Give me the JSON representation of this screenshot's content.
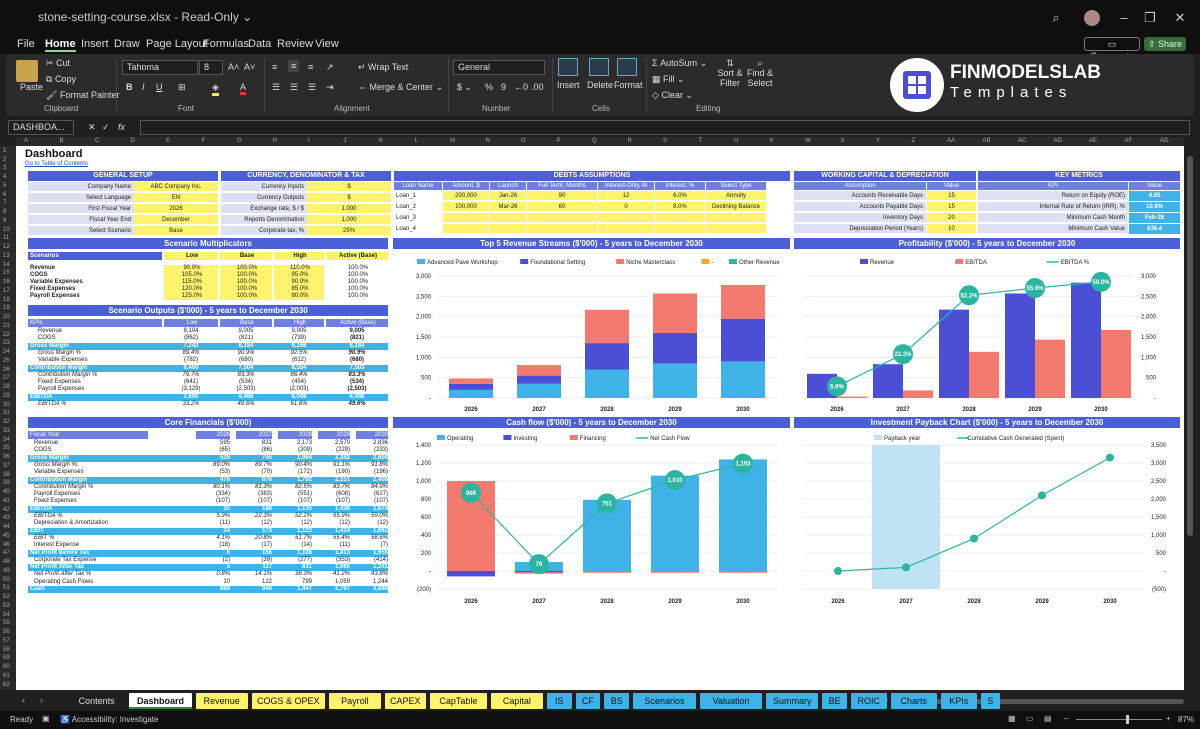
{
  "titlebar": {
    "filename": "stone-setting-course.xlsx",
    "mode": "Read-Only"
  },
  "menus": [
    "File",
    "Home",
    "Insert",
    "Draw",
    "Page Layout",
    "Formulas",
    "Data",
    "Review",
    "View"
  ],
  "menu_right": {
    "comments": "Comments",
    "share": "Share"
  },
  "ribbon": {
    "paste": "Paste",
    "cut": "Cut",
    "copy": "Copy",
    "format_painter": "Format Painter",
    "clipboard": "Clipboard",
    "font_name": "Tahoma",
    "font_size": "8",
    "font": "Font",
    "wrap_text": "Wrap Text",
    "merge_center": "Merge & Center",
    "alignment": "Alignment",
    "number_format": "General",
    "number": "Number",
    "insert": "Insert",
    "delete": "Delete",
    "format": "Format",
    "cells": "Cells",
    "autosum": "AutoSum",
    "fill": "Fill",
    "clear": "Clear",
    "sort_filter": "Sort & Filter",
    "find_select": "Find & Select",
    "editing": "Editing",
    "logo_title": "FINMODELSLAB",
    "logo_sub": "Templates"
  },
  "formula_bar": {
    "name_box": "DASHBOA...",
    "fx": "fx",
    "value": ""
  },
  "columns": [
    "A",
    "B",
    "C",
    "D",
    "E",
    "F",
    "G",
    "H",
    "I",
    "J",
    "K",
    "L",
    "M",
    "N",
    "O",
    "P",
    "Q",
    "R",
    "S",
    "T",
    "U",
    "V",
    "W",
    "X",
    "Y",
    "Z",
    "AA",
    "AB",
    "AC",
    "AD",
    "AE",
    "AF",
    "AG"
  ],
  "sheet": {
    "title": "Dashboard",
    "toc_link": "Go to Table of Contents",
    "general_setup": {
      "header": "GENERAL SETUP",
      "rows": [
        [
          "Company Name",
          "ABC Company Inc."
        ],
        [
          "Select Language",
          "EN"
        ],
        [
          "First Fiscal Year",
          "2026"
        ],
        [
          "Fiscal Year End",
          "December"
        ],
        [
          "Select Scenario",
          "Base"
        ]
      ]
    },
    "currency": {
      "header": "CURRENCY, DENOMINATOR & TAX",
      "rows": [
        [
          "Currency Inputs",
          "$"
        ],
        [
          "Currency Outputs",
          "$"
        ],
        [
          "Exchange rate, $ / $",
          "1.000"
        ],
        [
          "Reports Denomination",
          "1,000"
        ],
        [
          "Corporate tax, %",
          "25%"
        ]
      ]
    },
    "debts": {
      "header": "DEBTS ASSUMPTIONS",
      "cols": [
        "Loan Name",
        "Amount, $",
        "Launch",
        "Full Term, Months",
        "Interest-Only, M",
        "Interest, %",
        "Select Type"
      ],
      "rows": [
        [
          "Loan_1",
          "200,000",
          "Jan-26",
          "90",
          "12",
          "6.0%",
          "Annuity"
        ],
        [
          "Loan_2",
          "100,000",
          "Mar-26",
          "60",
          "0",
          "8.0%",
          "Declining Balance"
        ],
        [
          "Loan_3",
          "",
          "",
          "",
          "",
          "",
          ""
        ],
        [
          "Loan_4",
          "",
          "",
          "",
          "",
          "",
          ""
        ]
      ]
    },
    "working_capital": {
      "header": "WORKING CAPITAL & DEPRECIATION",
      "cols": [
        "Assumption",
        "Value"
      ],
      "rows": [
        [
          "Accounts Receivable Days",
          "15"
        ],
        [
          "Accounts Payable Days",
          "15"
        ],
        [
          "Inventory Days",
          "20"
        ],
        [
          "Depreciation Period (Years)",
          "10"
        ]
      ]
    },
    "key_metrics": {
      "header": "KEY METRICS",
      "cols": [
        "KPI",
        "Value"
      ],
      "rows": [
        [
          "Return on Equity (ROE)",
          "4.65"
        ],
        [
          "Internal Rate of Return (IRR), %",
          "10.8%"
        ],
        [
          "Minimum Cash Month",
          "Feb-26"
        ],
        [
          "Minimum Cash Value",
          "838.4"
        ]
      ]
    },
    "scenario_mult": {
      "header": "Scenario Multiplicators",
      "cols": [
        "Scenarios",
        "Low",
        "Base",
        "High",
        "Active (Base)"
      ],
      "rows": [
        [
          "Revenue",
          "90.0%",
          "100.0%",
          "110.0%",
          "100.0%"
        ],
        [
          "COGS",
          "105.0%",
          "100.0%",
          "95.0%",
          "100.0%"
        ],
        [
          "Variable Expenses",
          "115.0%",
          "100.0%",
          "90.0%",
          "100.0%"
        ],
        [
          "Fixed Expenses",
          "120.0%",
          "100.0%",
          "85.0%",
          "100.0%"
        ],
        [
          "Payroll Expenses",
          "125.0%",
          "100.0%",
          "80.0%",
          "100.0%"
        ]
      ]
    },
    "scenario_out": {
      "header": "Scenario Outputs ($'000) - 5 years to December 2030",
      "cols": [
        "KPIs",
        "Low",
        "Base",
        "High",
        "Active (Base)"
      ],
      "rows": [
        [
          "Revenue",
          "8,104",
          "9,005",
          "9,905",
          "9,005",
          ""
        ],
        [
          "COGS",
          "(862)",
          "(821)",
          "(739)",
          "(821)",
          ""
        ],
        [
          "Gross Margin",
          "7,242",
          "8,184",
          "9,166",
          "8,184",
          "cyan"
        ],
        [
          "Gross Margin %",
          "89.4%",
          "90.9%",
          "92.5%",
          "90.9%",
          "i"
        ],
        [
          "Variable Expenses",
          "(782)",
          "(680)",
          "(612)",
          "(680)",
          ""
        ],
        [
          "Contribution Margin",
          "6,460",
          "7,504",
          "8,554",
          "7,503",
          "cyan"
        ],
        [
          "Contribution Margin %",
          "79.7%",
          "83.3%",
          "86.4%",
          "83.3%",
          "i"
        ],
        [
          "Fixed Expenses",
          "(641)",
          "(534)",
          "(454)",
          "(534)",
          ""
        ],
        [
          "Payroll Expenses",
          "(3,129)",
          "(2,503)",
          "(2,003)",
          "(2,503)",
          ""
        ],
        [
          "EBITDA",
          "2,690",
          "4,466",
          "6,098",
          "4,466",
          "cyan"
        ],
        [
          "EBITDA %",
          "33.2%",
          "49.6%",
          "61.6%",
          "49.6%",
          "i"
        ]
      ]
    },
    "core_fin": {
      "header": "Core Financials ($'000)",
      "cols": [
        "Fiscal Year",
        "2026",
        "2027",
        "2028",
        "2029",
        "2030"
      ],
      "rows": [
        [
          "Revenue",
          "595",
          "831",
          "2,173",
          "2,570",
          "2,836",
          ""
        ],
        [
          "COGS",
          "(65)",
          "(86)",
          "(209)",
          "(229)",
          "(233)",
          ""
        ],
        [
          "Gross Margin",
          "529",
          "745",
          "1,964",
          "2,342",
          "2,604",
          "cyan"
        ],
        [
          "Gross Margin %",
          "89.0%",
          "89.7%",
          "90.4%",
          "91.1%",
          "91.8%",
          "i"
        ],
        [
          "Variable Expenses",
          "(53)",
          "(70)",
          "(172)",
          "(190)",
          "(196)",
          ""
        ],
        [
          "Contribution Margin",
          "476",
          "676",
          "1,792",
          "2,151",
          "2,408",
          "cyan"
        ],
        [
          "Contribution Margin %",
          "80.1%",
          "81.3%",
          "82.5%",
          "83.7%",
          "84.9%",
          "i"
        ],
        [
          "Payroll Expenses",
          "(334)",
          "(383)",
          "(551)",
          "(608)",
          "(627)",
          ""
        ],
        [
          "Fixed Expenses",
          "(107)",
          "(107)",
          "(107)",
          "(107)",
          "(107)",
          ""
        ],
        [
          "EBITDA",
          "35",
          "186",
          "1,135",
          "1,436",
          "1,674",
          "cyan"
        ],
        [
          "EBITDA %",
          "5.9%",
          "22.3%",
          "52.2%",
          "55.9%",
          "59.0%",
          "i"
        ],
        [
          "Depreciation & Amortization",
          "(11)",
          "(12)",
          "(12)",
          "(12)",
          "(12)",
          ""
        ],
        [
          "EBIT",
          "24",
          "173",
          "1,122",
          "1,424",
          "1,662",
          "cyan"
        ],
        [
          "EBIT %",
          "4.1%",
          "20.8%",
          "51.7%",
          "55.4%",
          "58.6%",
          "i"
        ],
        [
          "Interest Expense",
          "(18)",
          "(17)",
          "(14)",
          "(11)",
          "(7)",
          ""
        ],
        [
          "Net Profit Before Tax",
          "6",
          "156",
          "1,108",
          "1,413",
          "1,655",
          "cyan"
        ],
        [
          "Corporate Tax Expense",
          "(2)",
          "(39)",
          "(277)",
          "(353)",
          "(414)",
          ""
        ],
        [
          "Net Profit After Tax",
          "5",
          "117",
          "831",
          "1,060",
          "1,241",
          "cyan"
        ],
        [
          "Net Profit After Tax %",
          "0.8%",
          "14.1%",
          "38.3%",
          "41.2%",
          "43.8%",
          "i"
        ],
        [
          "Operating Cash Flows",
          "10",
          "122",
          "799",
          "1,059",
          "1,244",
          ""
        ],
        [
          "Cash",
          "869",
          "946",
          "1,447",
          "2,707",
          "3,898",
          "cyan"
        ]
      ]
    }
  },
  "chart_data": [
    {
      "type": "bar",
      "title": "Top 5 Revenue Streams ($'000) - 5 years to December 2030",
      "categories": [
        "2026",
        "2027",
        "2028",
        "2029",
        "2030"
      ],
      "series": [
        {
          "name": "Advanced Pave Workshop",
          "values": [
            200,
            350,
            700,
            850,
            900
          ],
          "color": "#3fb3e8"
        },
        {
          "name": "Foundational Setting",
          "values": [
            150,
            200,
            650,
            750,
            1050
          ],
          "color": "#4b4fd6"
        },
        {
          "name": "Niche Masterclass",
          "values": [
            130,
            260,
            820,
            970,
            830
          ],
          "color": "#f27a6e"
        },
        {
          "name": "-",
          "values": [
            0,
            0,
            0,
            0,
            0
          ],
          "color": "#f5a623"
        },
        {
          "name": "Other Revenue",
          "values": [
            0,
            0,
            0,
            0,
            0
          ],
          "color": "#2bb5a0"
        }
      ],
      "ylim": [
        0,
        3000
      ],
      "yticks": [
        "-",
        "500",
        "1,000",
        "1,500",
        "2,000",
        "2,500",
        "3,000"
      ]
    },
    {
      "type": "bar",
      "title": "Profitability ($'000) - 5 years to December 2030",
      "categories": [
        "2026",
        "2027",
        "2028",
        "2029",
        "2030"
      ],
      "series": [
        {
          "name": "Revenue",
          "values": [
            595,
            831,
            2173,
            2570,
            2836
          ],
          "color": "#4b4fd6"
        },
        {
          "name": "EBITDA",
          "values": [
            35,
            186,
            1135,
            1436,
            1674
          ],
          "color": "#f27a6e"
        },
        {
          "name": "EBITDA %",
          "values": [
            5.9,
            22.3,
            52.2,
            55.9,
            59.0
          ],
          "labels": [
            "5.9%",
            "22.3%",
            "52.2%",
            "55.9%",
            "59.0%"
          ],
          "color": "#2bb5a0"
        }
      ],
      "ylim": [
        0,
        3000
      ],
      "yticks": [
        "-",
        "500",
        "1,000",
        "1,500",
        "2,000",
        "2,500",
        "3,000"
      ]
    },
    {
      "type": "bar",
      "title": "Cash flow ($'000) - 5 years to December 2030",
      "categories": [
        "2026",
        "2027",
        "2028",
        "2029",
        "2030"
      ],
      "series": [
        {
          "name": "Operating",
          "values": [
            0,
            100,
            790,
            1060,
            1240
          ],
          "color": "#3fb3e8"
        },
        {
          "name": "Investing",
          "values": [
            -60,
            -15,
            0,
            0,
            0
          ],
          "color": "#4b4fd6"
        },
        {
          "name": "Financing",
          "values": [
            1000,
            -15,
            -20,
            -20,
            -20
          ],
          "color": "#f27a6e"
        },
        {
          "name": "Net Cash Flow",
          "values": [
            869,
            76,
            751,
            1010,
            1193
          ],
          "labels": [
            "869",
            "76",
            "751",
            "1,010",
            "1,193"
          ],
          "color": "#2bb5a0"
        }
      ],
      "ylim": [
        -200,
        1400
      ],
      "yticks": [
        "(200)",
        "-",
        "200",
        "400",
        "600",
        "800",
        "1,000",
        "1,200",
        "1,400"
      ]
    },
    {
      "type": "line",
      "title": "Investment Payback Chart ($'000) - 5 years to December 2030",
      "categories": [
        "2026",
        "2027",
        "2028",
        "2029",
        "2030"
      ],
      "series": [
        {
          "name": "Payback year",
          "values": [
            0,
            1,
            0,
            0,
            0
          ],
          "color": "#bfe3f5"
        },
        {
          "name": "Cumulative Cash Generated (Spent)",
          "values": [
            0,
            100,
            900,
            2100,
            3150
          ],
          "color": "#2bb5a0"
        }
      ],
      "ylim": [
        -500,
        3500
      ],
      "yticks": [
        "(500)",
        "-",
        "500",
        "1,000",
        "1,500",
        "2,000",
        "2,500",
        "3,000",
        "3,500"
      ]
    }
  ],
  "tabs": [
    {
      "label": "Contents",
      "color": "#1f1f1f",
      "text": "#ddd"
    },
    {
      "label": "Dashboard",
      "color": "#ffffff",
      "text": "#111"
    },
    {
      "label": "Revenue",
      "color": "#fff36e"
    },
    {
      "label": "COGS & OPEX",
      "color": "#fff36e"
    },
    {
      "label": "Payroll",
      "color": "#fff36e"
    },
    {
      "label": "CAPEX",
      "color": "#fff36e"
    },
    {
      "label": "CapTable",
      "color": "#fff36e"
    },
    {
      "label": "Capital",
      "color": "#fff36e"
    },
    {
      "label": "IS",
      "color": "#3fb3e8"
    },
    {
      "label": "CF",
      "color": "#3fb3e8"
    },
    {
      "label": "BS",
      "color": "#3fb3e8"
    },
    {
      "label": "Scenarios",
      "color": "#3fb3e8"
    },
    {
      "label": "Valuation",
      "color": "#3fb3e8"
    },
    {
      "label": "Summary",
      "color": "#3fb3e8"
    },
    {
      "label": "BE",
      "color": "#3fb3e8"
    },
    {
      "label": "ROIC",
      "color": "#3fb3e8"
    },
    {
      "label": "Charts",
      "color": "#3fb3e8"
    },
    {
      "label": "KPIs",
      "color": "#3fb3e8"
    },
    {
      "label": "S",
      "color": "#3fb3e8"
    }
  ],
  "status": {
    "ready": "Ready",
    "accessibility": "Accessibility: Investigate",
    "zoom": "87%"
  }
}
